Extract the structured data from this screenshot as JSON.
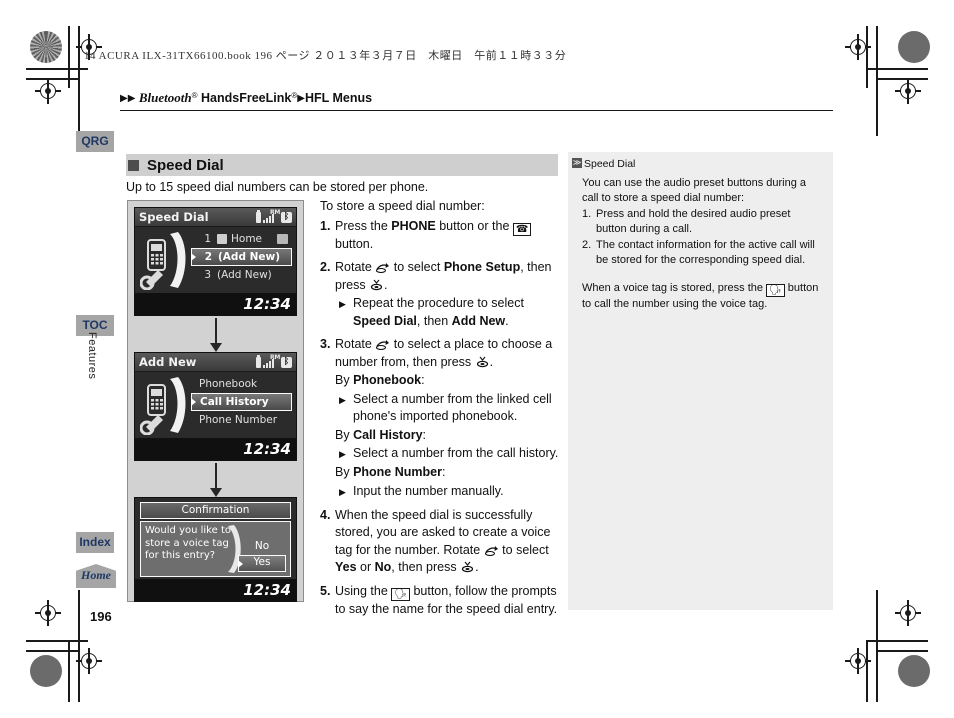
{
  "print": {
    "slug": "14 ACURA ILX-31TX66100.book   196 ページ   ２０１３年３月７日　木曜日　午前１１時３３分"
  },
  "breadcrumb": {
    "arrow": "▶",
    "item1": "Bluetooth",
    "item1_sup": "®",
    "item2": "HandsFreeLink",
    "item2_sup": "®",
    "item3": "HFL Menus"
  },
  "side_tabs": {
    "qrg": "QRG",
    "toc": "TOC",
    "index": "Index",
    "home": "Home",
    "vertical": "Features"
  },
  "section": {
    "title": "Speed Dial",
    "intro": "Up to 15 speed dial numbers can be stored per phone."
  },
  "screens": [
    {
      "title": "Speed Dial",
      "clock": "12:34",
      "rows": [
        {
          "index": "1",
          "label": "Home",
          "selected": false,
          "has_home_icon": true,
          "has_trail_icon": true
        },
        {
          "index": "2",
          "label": "(Add New)",
          "selected": true,
          "has_home_icon": false,
          "has_trail_icon": false
        },
        {
          "index": "3",
          "label": "(Add New)",
          "selected": false,
          "has_home_icon": false,
          "has_trail_icon": false
        }
      ]
    },
    {
      "title": "Add New",
      "clock": "12:34",
      "rows": [
        {
          "index": "",
          "label": "Phonebook",
          "selected": false,
          "has_home_icon": false,
          "has_trail_icon": false
        },
        {
          "index": "",
          "label": "Call History",
          "selected": true,
          "has_home_icon": false,
          "has_trail_icon": false
        },
        {
          "index": "",
          "label": "Phone Number",
          "selected": false,
          "has_home_icon": false,
          "has_trail_icon": false
        }
      ]
    }
  ],
  "confirmation_screen": {
    "title": "Confirmation",
    "question": "Would you like to store a voice tag for this entry?",
    "option_no": "No",
    "option_yes": "Yes",
    "clock": "12:34"
  },
  "steps": {
    "lead": "To store a speed dial number:",
    "s1": {
      "num": "1.",
      "a": "Press the ",
      "b": "PHONE",
      "c": " button or the ",
      "icon": "phone-handset-icon",
      "d": " button."
    },
    "s2": {
      "num": "2.",
      "a": "Rotate ",
      "icon": "rotary-knob-icon",
      "b": " to select ",
      "c": "Phone Setup",
      "d": ", then press ",
      "icon2": "press-knob-icon",
      "e": ".",
      "sub": {
        "tri": "▶",
        "a": "Repeat the procedure to select ",
        "b": "Speed Dial",
        "c": ", then ",
        "d": "Add New",
        "e": "."
      }
    },
    "s3": {
      "num": "3.",
      "a": "Rotate ",
      "icon": "rotary-knob-icon",
      "b": " to select a place to choose a number from, then press ",
      "icon2": "press-knob-icon",
      "c": ".",
      "by1_pre": "By ",
      "by1_b": "Phonebook",
      "by1_post": ":",
      "sub1_tri": "▶",
      "sub1": "Select a number from the linked cell phone's imported phonebook.",
      "by2_pre": "By ",
      "by2_b": "Call History",
      "by2_post": ":",
      "sub2_tri": "▶",
      "sub2": "Select a number from the call history.",
      "by3_pre": "By ",
      "by3_b": "Phone Number",
      "by3_post": ":",
      "sub3_tri": "▶",
      "sub3": "Input the number manually."
    },
    "s4": {
      "num": "4.",
      "a": "When the speed dial is successfully stored, you are asked to create a voice tag for the number. Rotate ",
      "icon": "rotary-knob-icon",
      "b": " to select ",
      "c": "Yes",
      "d": " or ",
      "e": "No",
      "f": ", then press ",
      "icon2": "press-knob-icon",
      "g": "."
    },
    "s5": {
      "num": "5.",
      "a": "Using the ",
      "icon": "talk-button-icon",
      "b": " button, follow the prompts to say the name for the speed dial entry."
    }
  },
  "note": {
    "marker": "≫",
    "title": "Speed Dial",
    "p1": "You can use the audio preset buttons during a call to store a speed dial number:",
    "list": [
      {
        "n": "1.",
        "text": "Press and hold the desired audio preset button during a call."
      },
      {
        "n": "2.",
        "text": "The contact information for the active call will be stored for the corresponding speed dial."
      }
    ],
    "p2_a": "When a voice tag is stored, press the ",
    "p2_icon": "talk-button-icon",
    "p2_b": " button to call the number using the voice tag."
  },
  "page_number": "196",
  "colors": {
    "tab": "#a5a5a5",
    "tab_text": "#1f3864",
    "section_band": "#cfcfcf",
    "image_panel": "#d2d2d2",
    "note_panel": "#eeeeee"
  }
}
